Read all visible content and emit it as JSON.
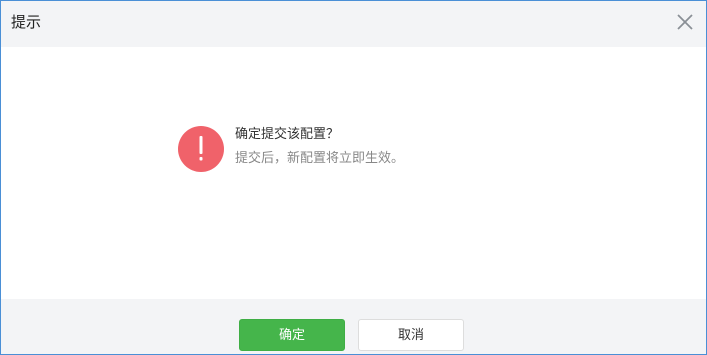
{
  "dialog": {
    "title": "提示",
    "close_icon": "close-icon",
    "message": {
      "icon": "exclamation-icon",
      "icon_color": "#f0626a",
      "title": "确定提交该配置？",
      "subtitle": "提交后，新配置将立即生效。"
    },
    "footer": {
      "ok_label": "确定",
      "cancel_label": "取消",
      "ok_color": "#45b54b"
    }
  }
}
